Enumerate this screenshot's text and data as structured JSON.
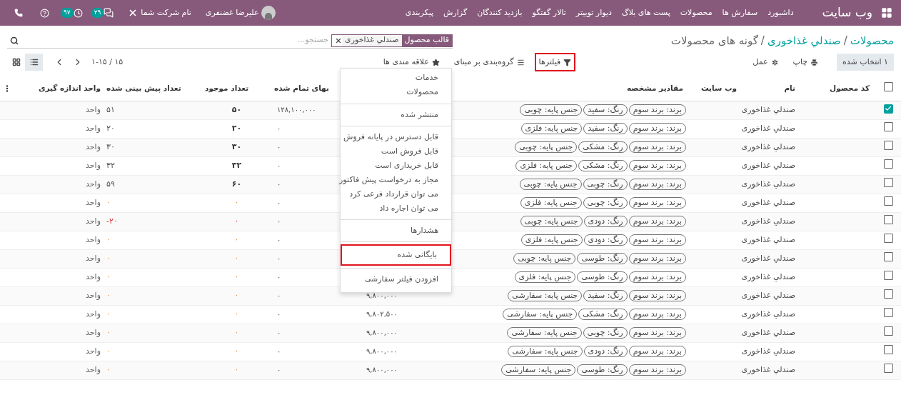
{
  "navbar": {
    "brand": "وب سایت",
    "menu": [
      "داشبورد",
      "سفارش ها",
      "محصولات",
      "پست های بلاگ",
      "دیوار توییتر",
      "تالار گفتگو",
      "بازدید کنندگان",
      "گزارش",
      "پیکربندی"
    ],
    "activity_count": "۹۷",
    "message_count": "۲۹",
    "company": "نام شرکت شما",
    "user": "علیرضا غضنفری"
  },
  "breadcrumb": [
    {
      "kind": "link",
      "label": "محصولات"
    },
    {
      "kind": "separator",
      "label": "/"
    },
    {
      "kind": "link",
      "label": "صندلي غذاخوری"
    },
    {
      "kind": "separator",
      "label": "/"
    },
    {
      "kind": "current",
      "label": "گونه های محصولات"
    }
  ],
  "search": {
    "facet_label": "قالب محصول",
    "facet_value": "صندلي غذاخوری",
    "placeholder": "جستجو..."
  },
  "selection": "۱ انتخاب شده",
  "actions": [
    {
      "kind": "print",
      "label": "چاپ"
    },
    {
      "kind": "action",
      "label": "عمل"
    }
  ],
  "search_buttons": [
    {
      "kind": "filter",
      "label": "فیلترها",
      "highlighted": true
    },
    {
      "kind": "group",
      "label": "گروه‌بندی بر مبنای",
      "highlighted": false
    },
    {
      "kind": "favorite",
      "label": "علاقه مندی ها",
      "highlighted": false
    }
  ],
  "pager": "۱-۱۵ / ۱۵",
  "views": [
    {
      "kind": "list",
      "selected": true
    },
    {
      "kind": "kanban",
      "selected": false
    }
  ],
  "table": {
    "select_all": false,
    "columns": [
      "کد محصول",
      "نام",
      "وب سایت",
      "مقادیر مشخصه",
      "بهای تمام شده",
      "تعداد موجود",
      "تعداد پیش بینی شده",
      "واحد اندازه گیری"
    ],
    "rows": [
      {
        "kind": "in_stock",
        "selected": true,
        "name": "صندلي غذاخوری",
        "tags": [
          "برند: برند سوم",
          "رنگ: سفید",
          "جنس پایه: چوبی"
        ],
        "cost": "۱۲۸,۱۰۰,۰۰۰",
        "on_hand": "۵۰",
        "forecast": "۵۱",
        "uom": "واحد"
      },
      {
        "kind": "in_stock",
        "selected": false,
        "name": "صندلي غذاخوری",
        "tags": [
          "برند: برند سوم",
          "رنگ: سفید",
          "جنس پایه: فلزی"
        ],
        "cost": "۰",
        "on_hand": "۲۰",
        "forecast": "۲۰",
        "uom": "واحد"
      },
      {
        "kind": "in_stock",
        "selected": false,
        "name": "صندلي غذاخوری",
        "tags": [
          "برند: برند سوم",
          "رنگ: مشکی",
          "جنس پایه: چوبی"
        ],
        "cost": "۰",
        "on_hand": "۳۰",
        "forecast": "۳۰",
        "uom": "واحد"
      },
      {
        "kind": "in_stock",
        "selected": false,
        "name": "صندلي غذاخوری",
        "tags": [
          "برند: برند سوم",
          "رنگ: مشکی",
          "جنس پایه: فلزی"
        ],
        "cost": "۰",
        "on_hand": "۳۲",
        "forecast": "۳۲",
        "uom": "واحد"
      },
      {
        "kind": "in_stock",
        "selected": false,
        "name": "صندلي غذاخوری",
        "tags": [
          "برند: برند سوم",
          "رنگ: چوبی",
          "جنس پایه: چوبی"
        ],
        "cost": "۰",
        "on_hand": "۶۰",
        "forecast": "۵۹",
        "uom": "واحد"
      },
      {
        "kind": "empty",
        "selected": false,
        "name": "صندلي غذاخوری",
        "tags": [
          "برند: برند سوم",
          "رنگ: چوبی",
          "جنس پایه: فلزی"
        ],
        "cost": "۰",
        "on_hand": "۰",
        "forecast": "۰",
        "uom": "واحد"
      },
      {
        "kind": "negative",
        "selected": false,
        "name": "صندلي غذاخوری",
        "tags": [
          "برند: برند سوم",
          "رنگ: دودی",
          "جنس پایه: چوبی"
        ],
        "cost": "۰",
        "on_hand": "۰",
        "forecast": "۲۰-",
        "uom": "واحد"
      },
      {
        "kind": "empty",
        "selected": false,
        "name": "صندلي غذاخوری",
        "tags": [
          "برند: برند سوم",
          "رنگ: دودی",
          "جنس پایه: فلزی"
        ],
        "cost": "۰",
        "on_hand": "۰",
        "forecast": "۰",
        "uom": "واحد"
      },
      {
        "kind": "empty",
        "selected": false,
        "name": "صندلي غذاخوری",
        "tags": [
          "برند: برند سوم",
          "رنگ: طوسی",
          "جنس پایه: چوبی"
        ],
        "cost": "۰",
        "on_hand": "۰",
        "forecast": "۰",
        "uom": "واحد"
      },
      {
        "kind": "empty",
        "selected": false,
        "name": "صندلي غذاخوری",
        "tags": [
          "برند: برند سوم",
          "رنگ: طوسی",
          "جنس پایه: فلزی"
        ],
        "cost": "۰",
        "on_hand": "۰",
        "forecast": "۰",
        "uom": "واحد"
      },
      {
        "kind": "empty",
        "selected": false,
        "name": "صندلي غذاخوری",
        "tags": [
          "برند: برند سوم",
          "رنگ: سفید",
          "جنس پایه: سفارشی"
        ],
        "column_5": "۹,۸۰۰,۰۰۰",
        "cost": "۰",
        "on_hand": "۰",
        "forecast": "۰",
        "uom": "واحد"
      },
      {
        "kind": "empty",
        "selected": false,
        "name": "صندلي غذاخوری",
        "tags": [
          "برند: برند سوم",
          "رنگ: مشکی",
          "جنس پایه: سفارشی"
        ],
        "column_5": "۹,۸۰۲,۵۰۰",
        "cost": "۰",
        "on_hand": "۰",
        "forecast": "۰",
        "uom": "واحد"
      },
      {
        "kind": "empty",
        "selected": false,
        "name": "صندلي غذاخوری",
        "tags": [
          "برند: برند سوم",
          "رنگ: چوبی",
          "جنس پایه: سفارشی"
        ],
        "column_5": "۹,۸۰۰,۰۰۰",
        "cost": "۰",
        "on_hand": "۰",
        "forecast": "۰",
        "uom": "واحد"
      },
      {
        "kind": "empty",
        "selected": false,
        "name": "صندلي غذاخوری",
        "tags": [
          "برند: برند سوم",
          "رنگ: دودی",
          "جنس پایه: سفارشی"
        ],
        "column_5": "۹,۸۰۰,۰۰۰",
        "cost": "۰",
        "on_hand": "۰",
        "forecast": "۰",
        "uom": "واحد"
      },
      {
        "kind": "empty",
        "selected": false,
        "name": "صندلي غذاخوری",
        "tags": [
          "برند: برند سوم",
          "رنگ: طوسی",
          "جنس پایه: سفارشی"
        ],
        "column_5": "۹,۸۰۰,۰۰۰",
        "cost": "۰",
        "on_hand": "۰",
        "forecast": "۰",
        "uom": "واحد"
      }
    ]
  },
  "filter_menu": [
    {
      "items": [
        {
          "label": "خدمات",
          "highlighted": false
        },
        {
          "label": "محصولات",
          "highlighted": false
        }
      ]
    },
    {
      "items": [
        {
          "label": "منتشر شده",
          "highlighted": false
        }
      ]
    },
    {
      "items": [
        {
          "label": "قابل دسترس در پایانه فروش",
          "highlighted": false
        },
        {
          "label": "قابل فروش است",
          "highlighted": false
        },
        {
          "label": "قابل خریداری است",
          "highlighted": false
        },
        {
          "label": "مجاز به درخواست پیش فاکتور",
          "highlighted": false
        },
        {
          "label": "می توان قرارداد فرعی کرد",
          "highlighted": false
        },
        {
          "label": "می توان اجاره داد",
          "highlighted": false
        }
      ]
    },
    {
      "items": [
        {
          "label": "هشدارها",
          "highlighted": false
        }
      ]
    },
    {
      "items": [
        {
          "label": "بایگانی شده",
          "highlighted": true
        }
      ]
    },
    {
      "items": [
        {
          "label": "افزودن فیلتر سفارشی",
          "highlighted": false
        }
      ]
    }
  ]
}
